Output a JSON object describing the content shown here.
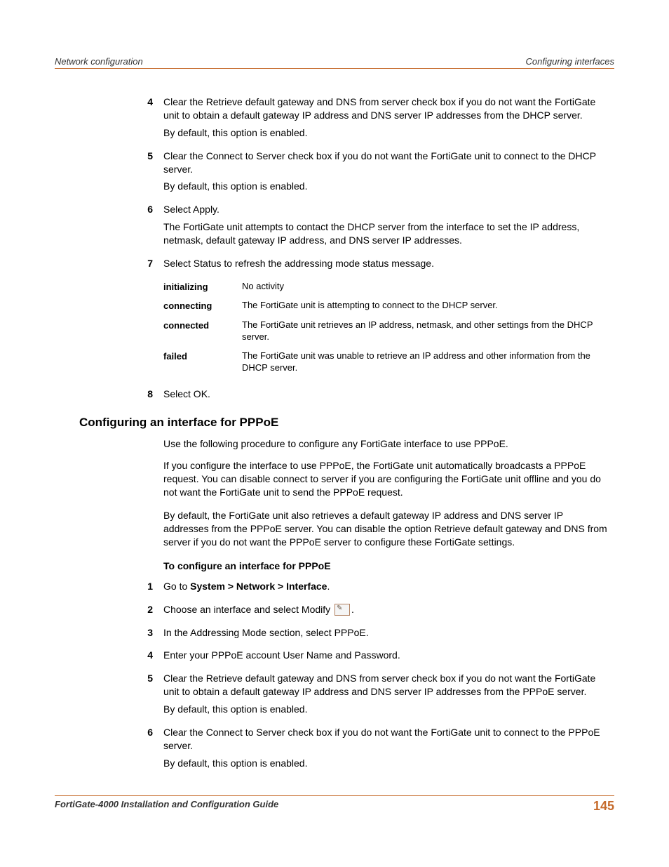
{
  "header": {
    "left": "Network configuration",
    "right": "Configuring interfaces"
  },
  "topSteps": [
    {
      "num": "4",
      "paras": [
        "Clear the Retrieve default gateway and DNS from server check box if you do not want the FortiGate unit to obtain a default gateway IP address and DNS server IP addresses from the DHCP server.",
        "By default, this option is enabled."
      ]
    },
    {
      "num": "5",
      "paras": [
        "Clear the Connect to Server check box if you do not want the FortiGate unit to connect to the DHCP server.",
        "By default, this option is enabled."
      ]
    },
    {
      "num": "6",
      "paras": [
        "Select Apply.",
        "The FortiGate unit attempts to contact the DHCP server from the interface to set the IP address, netmask, default gateway IP address, and DNS server IP addresses."
      ]
    },
    {
      "num": "7",
      "paras": [
        "Select Status to refresh the addressing mode status message."
      ]
    }
  ],
  "statusTable": [
    {
      "label": "initializing",
      "desc": "No activity"
    },
    {
      "label": "connecting",
      "desc": "The FortiGate unit is attempting to connect to the DHCP server."
    },
    {
      "label": "connected",
      "desc": "The FortiGate unit retrieves an IP address, netmask, and other settings from the DHCP server."
    },
    {
      "label": "failed",
      "desc": "The FortiGate unit was unable to retrieve an IP address and other information from the DHCP server."
    }
  ],
  "step8": {
    "num": "8",
    "text": "Select OK."
  },
  "section": {
    "heading": "Configuring an interface for PPPoE",
    "intro": [
      "Use the following procedure to configure any FortiGate interface to use PPPoE.",
      "If you configure the interface to use PPPoE, the FortiGate unit automatically broadcasts a PPPoE request. You can disable connect to server if you are configuring the FortiGate unit offline and you do not want the FortiGate unit to send the PPPoE request.",
      "By default, the FortiGate unit also retrieves a default gateway IP address and DNS server IP addresses from the PPPoE server. You can disable the option Retrieve default gateway and DNS from server if you do not want the PPPoE server to configure these FortiGate settings."
    ],
    "subHeading": "To configure an interface for PPPoE",
    "step1": {
      "num": "1",
      "prefix": "Go to ",
      "bold": "System > Network > Interface",
      "suffix": "."
    },
    "step2": {
      "num": "2",
      "prefix": "Choose an interface and select Modify ",
      "suffix": "."
    },
    "step3": {
      "num": "3",
      "text": "In the Addressing Mode section, select PPPoE."
    },
    "step4": {
      "num": "4",
      "text": "Enter your PPPoE account User Name and Password."
    },
    "step5": {
      "num": "5",
      "paras": [
        "Clear the Retrieve default gateway and DNS from server check box if you do not want the FortiGate unit to obtain a default gateway IP address and DNS server IP addresses from the PPPoE server.",
        "By default, this option is enabled."
      ]
    },
    "step6": {
      "num": "6",
      "paras": [
        "Clear the Connect to Server check box if you do not want the FortiGate unit to connect to the PPPoE server.",
        "By default, this option is enabled."
      ]
    }
  },
  "footer": {
    "left": "FortiGate-4000 Installation and Configuration Guide",
    "right": "145"
  }
}
